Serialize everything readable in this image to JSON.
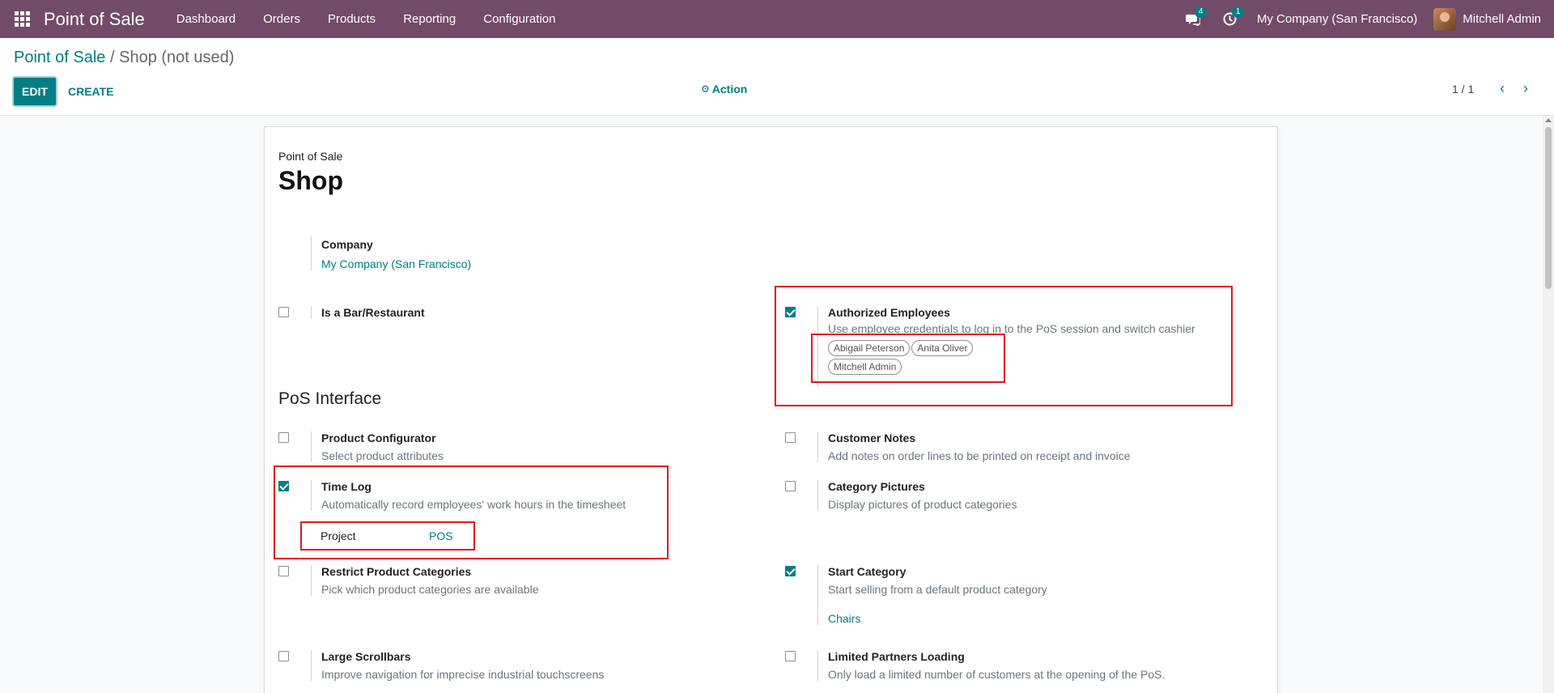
{
  "navbar": {
    "brand": "Point of Sale",
    "menu": [
      "Dashboard",
      "Orders",
      "Products",
      "Reporting",
      "Configuration"
    ],
    "messages_count": "4",
    "activities_count": "1",
    "company": "My Company (San Francisco)",
    "user": "Mitchell Admin"
  },
  "control_panel": {
    "breadcrumb_root": "Point of Sale",
    "breadcrumb_sep": "/",
    "breadcrumb_current": "Shop (not used)",
    "edit_label": "EDIT",
    "create_label": "CREATE",
    "action_label": "Action",
    "pager": "1 / 1"
  },
  "form": {
    "label": "Point of Sale",
    "title": "Shop",
    "company_label": "Company",
    "company_value": "My Company (San Francisco)",
    "bar_restaurant": {
      "title": "Is a Bar/Restaurant",
      "checked": false
    },
    "authorized_employees": {
      "title": "Authorized Employees",
      "desc": "Use employee credentials to log in to the PoS session and switch cashier",
      "checked": true,
      "tags": [
        "Abigail Peterson",
        "Anita Oliver",
        "Mitchell Admin"
      ]
    },
    "section_pos_interface": "PoS Interface",
    "product_configurator": {
      "title": "Product Configurator",
      "desc": "Select product attributes",
      "checked": false
    },
    "customer_notes": {
      "title": "Customer Notes",
      "desc": "Add notes on order lines to be printed on receipt and invoice",
      "checked": false
    },
    "time_log": {
      "title": "Time Log",
      "desc": "Automatically record employees' work hours in the timesheet",
      "checked": true,
      "project_label": "Project",
      "project_value": "POS"
    },
    "category_pictures": {
      "title": "Category Pictures",
      "desc": "Display pictures of product categories",
      "checked": false
    },
    "restrict_categories": {
      "title": "Restrict Product Categories",
      "desc": "Pick which product categories are available",
      "checked": false
    },
    "start_category": {
      "title": "Start Category",
      "desc": "Start selling from a default product category",
      "checked": true,
      "value": "Chairs"
    },
    "large_scrollbars": {
      "title": "Large Scrollbars",
      "desc": "Improve navigation for imprecise industrial touchscreens",
      "checked": false
    },
    "limited_partners": {
      "title": "Limited Partners Loading",
      "desc": "Only load a limited number of customers at the opening of the PoS.",
      "checked": false
    }
  },
  "colors": {
    "navbar": "#714b67",
    "accent": "#017e84",
    "highlight": "#e0161e"
  }
}
